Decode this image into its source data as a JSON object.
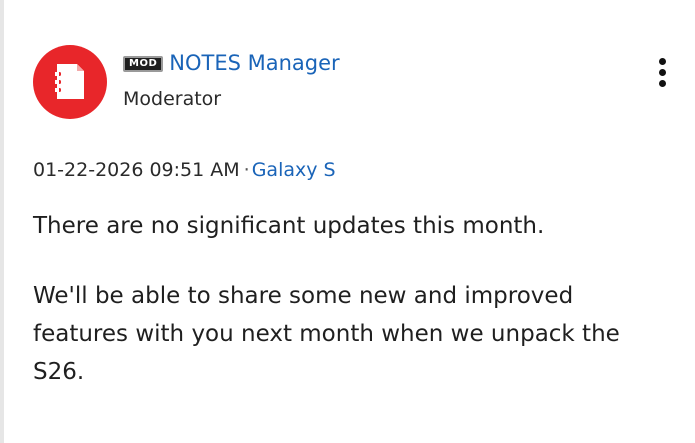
{
  "post": {
    "badge": "MOD",
    "author": "NOTES Manager",
    "role": "Moderator",
    "timestamp": "01-22-2026 09:51 AM",
    "separator": "·",
    "board": "Galaxy S",
    "paragraphs": [
      "There are no significant updates this month.",
      "We'll be able to share some new and improved features with you next month when we unpack the S26."
    ]
  },
  "icons": {
    "avatar": "notes-app-icon",
    "menu": "more-options-icon"
  },
  "colors": {
    "avatar_bg": "#e8262a",
    "link": "#1a64b8"
  }
}
